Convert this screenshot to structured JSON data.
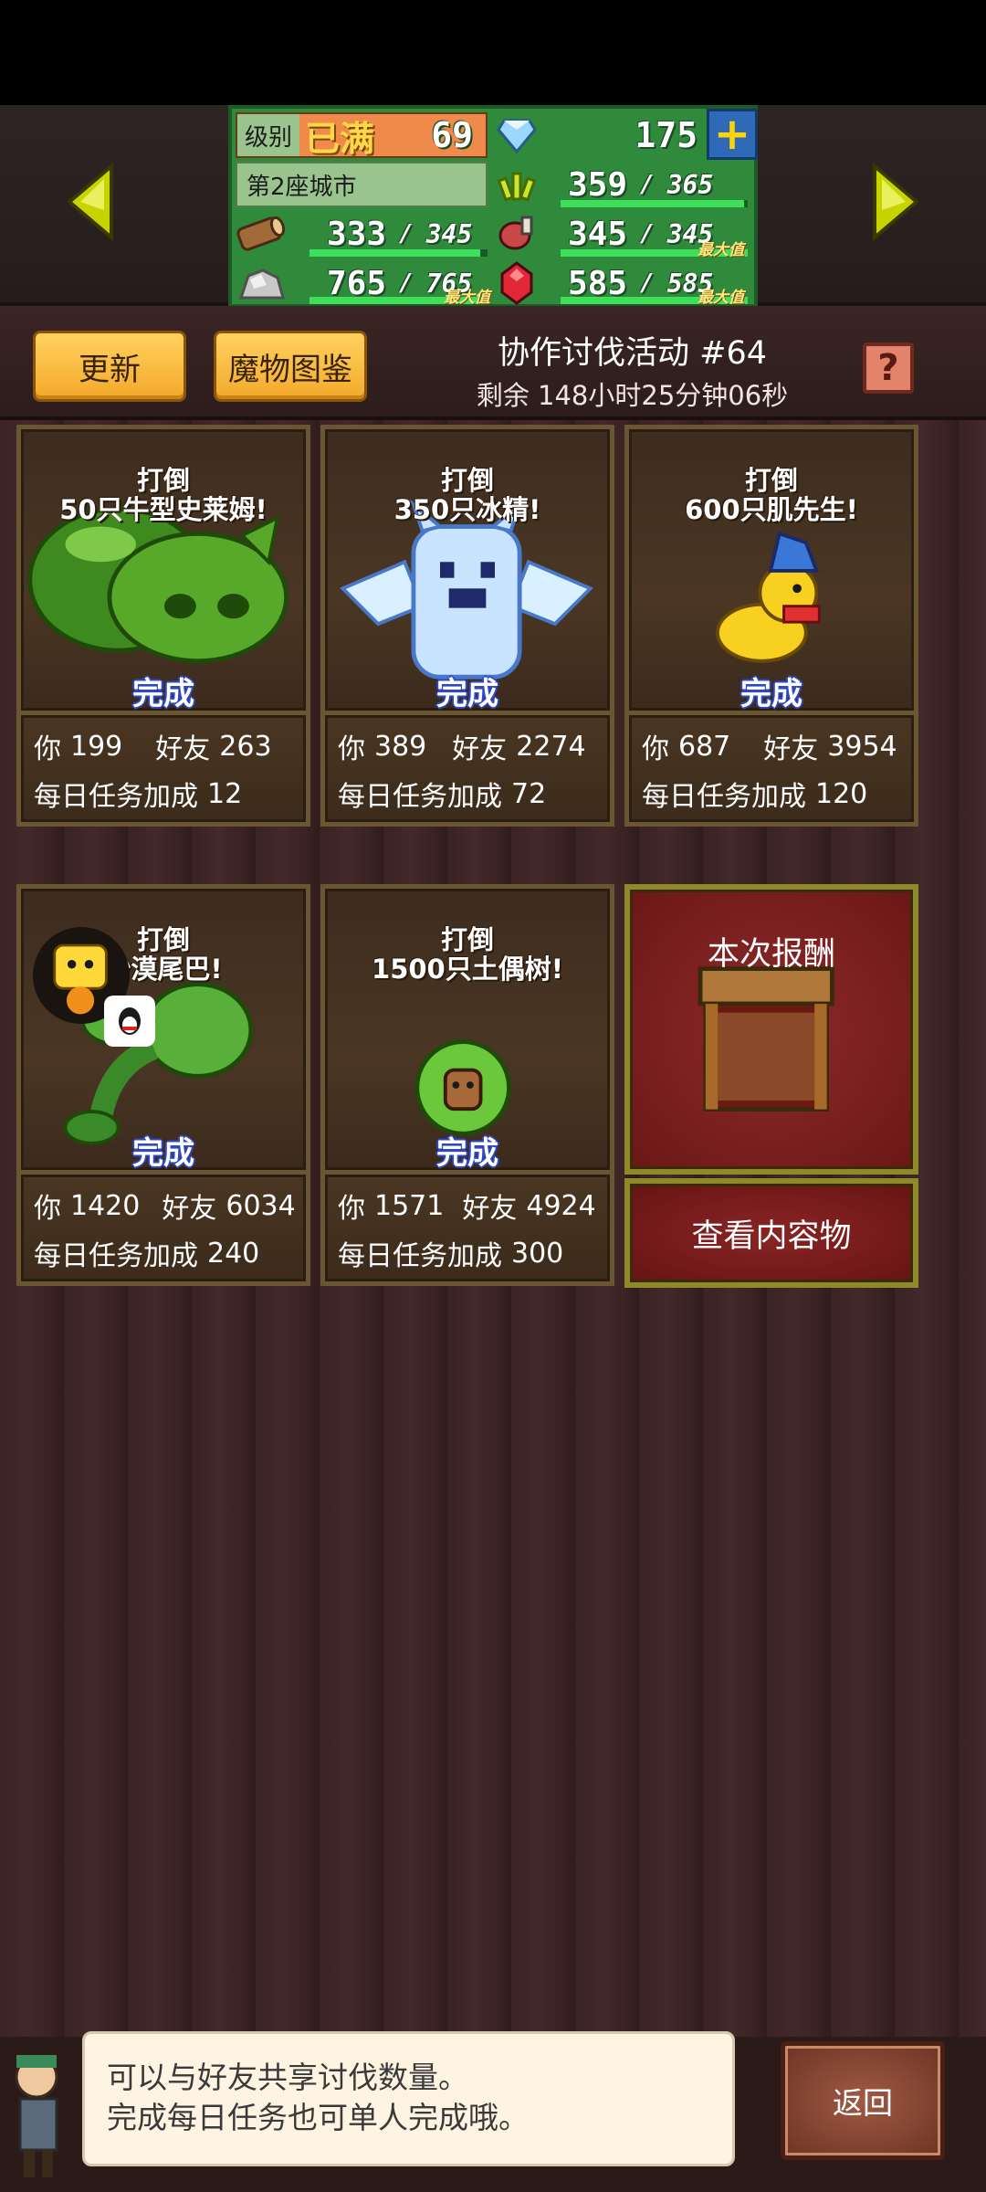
{
  "header": {
    "level_label": "级别",
    "level_badge": "已满",
    "level_value": "69",
    "city_label": "第2座城市",
    "gems": "175",
    "resources": [
      {
        "name": "wheat",
        "icon": "wheat-icon",
        "value": "359",
        "max": "365",
        "fill": 0.98,
        "max_tag": ""
      },
      {
        "name": "wood",
        "icon": "log-icon",
        "value": "333",
        "max": "345",
        "fill": 0.96,
        "max_tag": ""
      },
      {
        "name": "food",
        "icon": "meat-icon",
        "value": "345",
        "max": "345",
        "fill": 1.0,
        "max_tag": "最大值"
      },
      {
        "name": "stone",
        "icon": "ore-icon",
        "value": "765",
        "max": "765",
        "fill": 1.0,
        "max_tag": "最大值"
      },
      {
        "name": "ruby",
        "icon": "ruby-icon",
        "value": "585",
        "max": "585",
        "fill": 1.0,
        "max_tag": "最大值"
      }
    ],
    "separator": "/"
  },
  "toolbar": {
    "refresh_label": "更新",
    "bestiary_label": "魔物图鉴",
    "event_title": "协作讨伐活动 #64",
    "event_time": "剩余 148小时25分钟06秒",
    "help_label": "?"
  },
  "cards": [
    {
      "title_line1": "打倒",
      "title_line2": "50只牛型史莱姆!",
      "status": "完成",
      "you_label": "你",
      "you": "199",
      "friend_label": "好友",
      "friend": "263",
      "bonus_label": "每日任务加成",
      "bonus": "12",
      "monster_icon": "green-slime-icon"
    },
    {
      "title_line1": "打倒",
      "title_line2": "350只冰精!",
      "status": "完成",
      "you_label": "你",
      "you": "389",
      "friend_label": "好友",
      "friend": "2274",
      "bonus_label": "每日任务加成",
      "bonus": "72",
      "monster_icon": "ice-spirit-icon"
    },
    {
      "title_line1": "打倒",
      "title_line2": "600只肌先生!",
      "status": "完成",
      "you_label": "你",
      "you": "687",
      "friend_label": "好友",
      "friend": "3954",
      "bonus_label": "每日任务加成",
      "bonus": "120",
      "monster_icon": "yellow-bird-icon"
    },
    {
      "title_line1": "打倒",
      "title_line2": "沙漠尾巴!",
      "status": "完成",
      "you_label": "你",
      "you": "1420",
      "friend_label": "好友",
      "friend": "6034",
      "bonus_label": "每日任务加成",
      "bonus": "240",
      "monster_icon": "cactus-tail-icon"
    },
    {
      "title_line1": "打倒",
      "title_line2": "1500只土偶树!",
      "status": "完成",
      "you_label": "你",
      "you": "1571",
      "friend_label": "好友",
      "friend": "4924",
      "bonus_label": "每日任务加成",
      "bonus": "300",
      "monster_icon": "tree-doll-icon"
    }
  ],
  "reward": {
    "title": "本次报酬",
    "button_label": "查看内容物"
  },
  "dialog": {
    "line1": "可以与好友共享讨伐数量。",
    "line2": "完成每日任务也可单人完成哦。"
  },
  "back_label": "返回",
  "colors": {
    "panel_green": "#2f8a3c",
    "button_yellow": "#f3a92b",
    "status_blue": "#2f48c8",
    "reward_red": "#7a1c1c"
  }
}
